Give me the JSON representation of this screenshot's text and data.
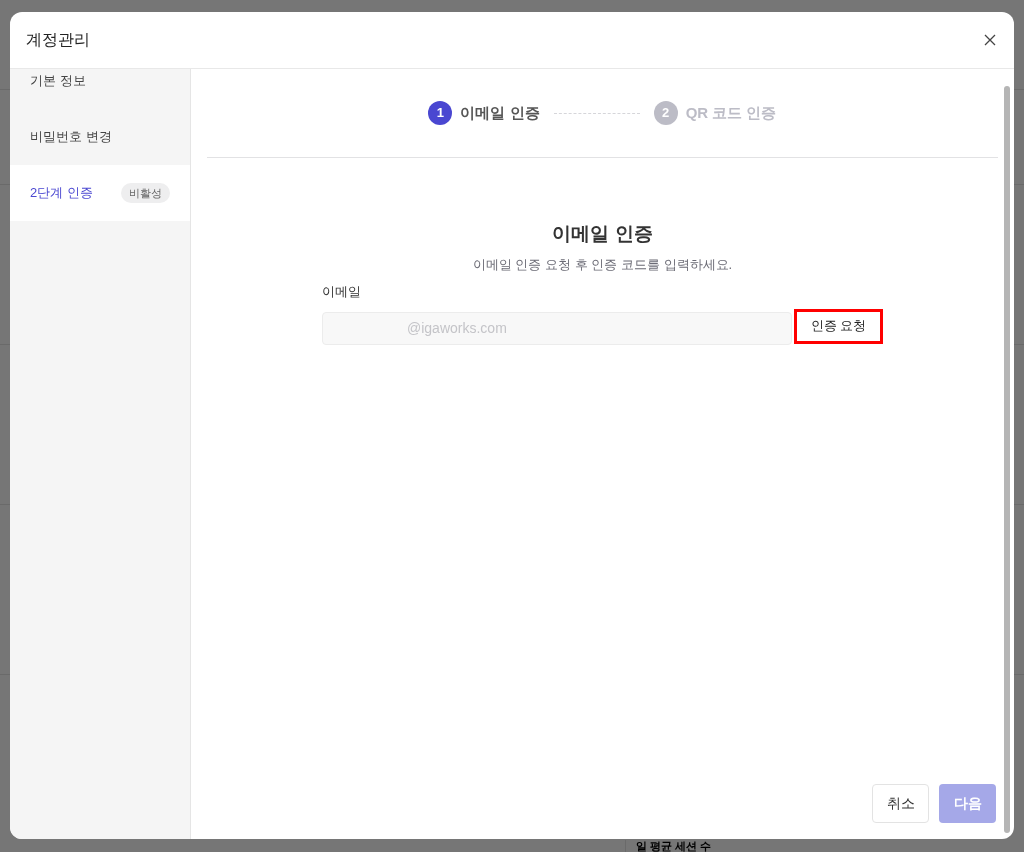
{
  "background": {
    "caption": "일 평균 세션 수"
  },
  "dialog": {
    "title": "계정관리"
  },
  "sidebar": {
    "items": [
      {
        "label": "기본 정보",
        "selected": false
      },
      {
        "label": "비밀번호 변경",
        "selected": false
      },
      {
        "label": "2단계 인증",
        "selected": true,
        "badge": "비활성"
      }
    ]
  },
  "steps": [
    {
      "number": "1",
      "label": "이메일 인증",
      "selected": true
    },
    {
      "number": "2",
      "label": "QR 코드 인증",
      "selected": false
    }
  ],
  "form": {
    "heading": "이메일 인증",
    "description": "이메일 인증 요청 후 인증 코드를 입력하세요.",
    "email_label": "이메일",
    "email_placeholder": "@igaworks.com",
    "request_button": "인증 요청",
    "request_highlighted": true
  },
  "buttons": [
    {
      "label": "취소",
      "kind": "secondary",
      "disabled": false
    },
    {
      "label": "다음",
      "kind": "primary",
      "disabled": true
    }
  ]
}
